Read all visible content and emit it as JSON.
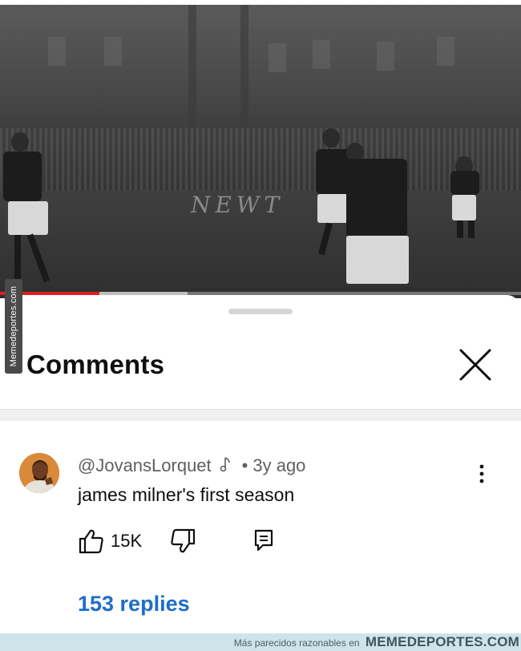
{
  "video": {
    "ad_board_text": "NEWT",
    "progress_fraction": 0.19,
    "buffer_end_fraction": 0.36
  },
  "side_watermark": "Memedeportes.com",
  "comments_panel": {
    "title": "Comments"
  },
  "comment": {
    "author": "@JovansLorquet",
    "time_ago": "3y ago",
    "separator": "•",
    "text": "james milner's first season",
    "likes": "15K",
    "replies_label": "153 replies"
  },
  "bottom_watermark": {
    "prefix": "Más parecidos razonables en",
    "brand": "MEMEDEPORTES.COM"
  },
  "colors": {
    "progress": "#e01e1e",
    "link": "#1e6ec8",
    "avatar_bg": "#d8893a"
  },
  "icons": [
    "close-icon",
    "music-note-icon",
    "more-vertical-icon",
    "thumb-up-icon",
    "thumb-down-icon",
    "reply-icon"
  ]
}
